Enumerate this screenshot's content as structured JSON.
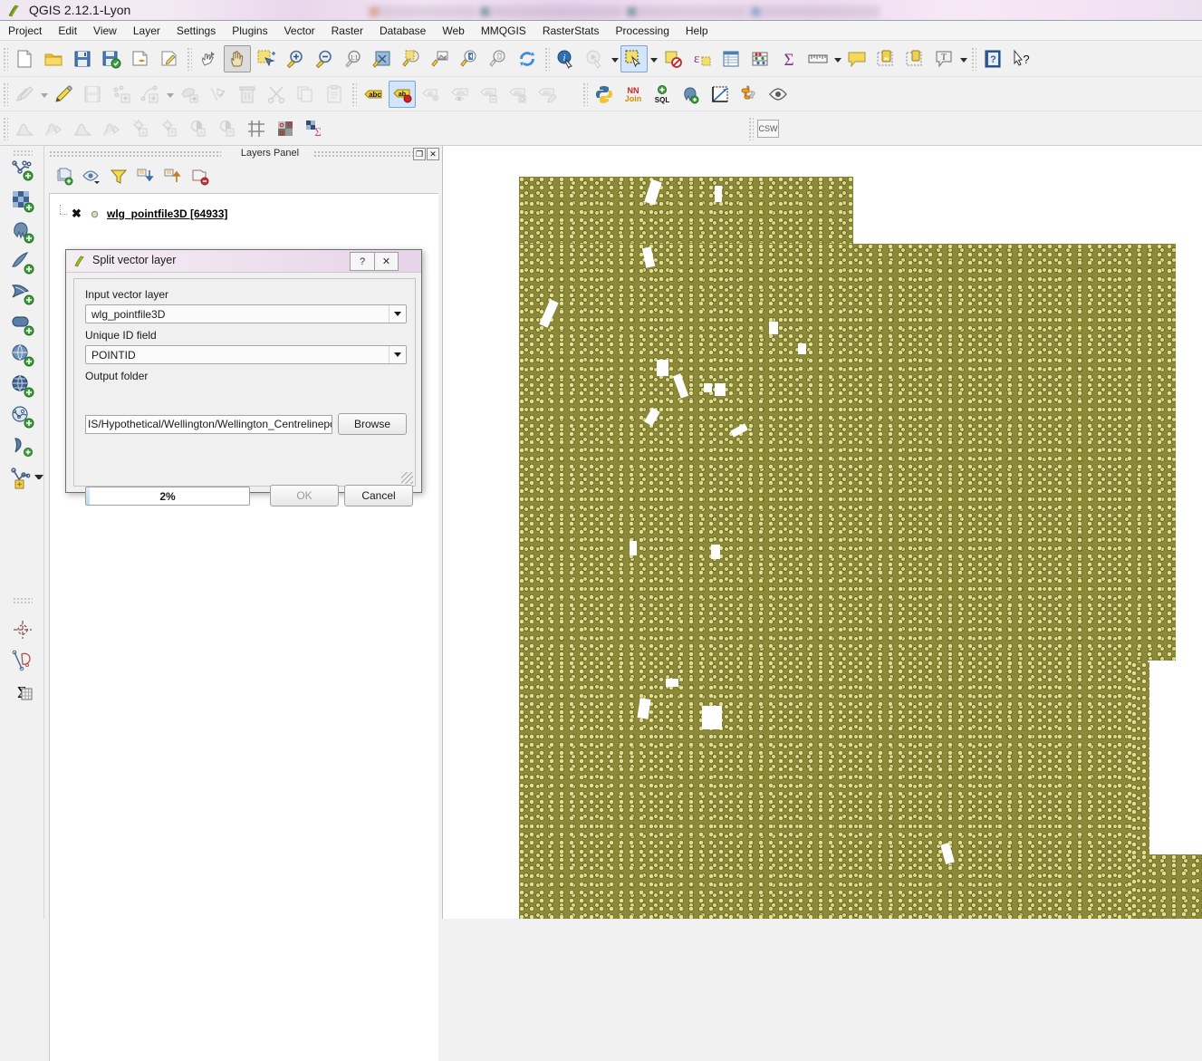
{
  "window": {
    "app_title": "QGIS 2.12.1-Lyon",
    "logo_icon": "qgis-leaf-icon"
  },
  "menubar": {
    "items": [
      {
        "label": "Project"
      },
      {
        "label": "Edit"
      },
      {
        "label": "View"
      },
      {
        "label": "Layer"
      },
      {
        "label": "Settings"
      },
      {
        "label": "Plugins"
      },
      {
        "label": "Vector"
      },
      {
        "label": "Raster"
      },
      {
        "label": "Database"
      },
      {
        "label": "Web"
      },
      {
        "label": "MMQGIS"
      },
      {
        "label": "RasterStats"
      },
      {
        "label": "Processing"
      },
      {
        "label": "Help"
      }
    ]
  },
  "toolbars": {
    "row1": [
      {
        "name": "new-project-icon",
        "type": "button"
      },
      {
        "name": "open-project-icon",
        "type": "button"
      },
      {
        "name": "save-project-icon",
        "type": "button"
      },
      {
        "name": "save-project-as-icon",
        "type": "button"
      },
      {
        "name": "new-print-composer-icon",
        "type": "button"
      },
      {
        "name": "composer-manager-icon",
        "type": "button"
      },
      {
        "name": "separator",
        "type": "sep"
      },
      {
        "name": "touch-zoom-pan-icon",
        "type": "button"
      },
      {
        "name": "pan-map-icon",
        "type": "button",
        "state": "active"
      },
      {
        "name": "pan-to-selection-icon",
        "type": "button"
      },
      {
        "name": "zoom-in-icon",
        "type": "button"
      },
      {
        "name": "zoom-out-icon",
        "type": "button"
      },
      {
        "name": "zoom-native-resolution-icon",
        "type": "button"
      },
      {
        "name": "zoom-full-extent-icon",
        "type": "button"
      },
      {
        "name": "zoom-to-selection-icon",
        "type": "button"
      },
      {
        "name": "zoom-to-layer-icon",
        "type": "button"
      },
      {
        "name": "zoom-last-icon",
        "type": "button"
      },
      {
        "name": "zoom-next-icon",
        "type": "button"
      },
      {
        "name": "refresh-icon",
        "type": "button"
      },
      {
        "name": "separator",
        "type": "sep"
      },
      {
        "name": "identify-features-icon",
        "type": "button"
      },
      {
        "name": "run-feature-action-icon",
        "type": "button",
        "state": "disabled"
      },
      {
        "name": "feature-action-dropdown-caret",
        "type": "caret"
      },
      {
        "name": "select-features-icon",
        "type": "button",
        "state": "selected"
      },
      {
        "name": "select-dropdown-caret",
        "type": "caret"
      },
      {
        "name": "deselect-features-icon",
        "type": "button"
      },
      {
        "name": "select-by-expression-icon",
        "type": "button"
      },
      {
        "name": "open-attribute-table-icon",
        "type": "button"
      },
      {
        "name": "field-calculator-icon",
        "type": "button"
      },
      {
        "name": "statistical-summary-icon",
        "type": "button"
      },
      {
        "name": "measure-line-icon",
        "type": "button"
      },
      {
        "name": "measure-dropdown-caret",
        "type": "caret"
      },
      {
        "name": "map-tips-icon",
        "type": "button"
      },
      {
        "name": "new-bookmark-icon",
        "type": "button"
      },
      {
        "name": "show-bookmarks-icon",
        "type": "button"
      },
      {
        "name": "text-annotation-icon",
        "type": "button"
      },
      {
        "name": "annotation-dropdown-caret",
        "type": "caret"
      },
      {
        "name": "separator",
        "type": "sep"
      },
      {
        "name": "help-contents-icon",
        "type": "button"
      },
      {
        "name": "whats-this-icon",
        "type": "button"
      }
    ],
    "row2": [
      {
        "name": "current-edits-icon",
        "type": "button",
        "state": "disabled"
      },
      {
        "name": "current-edits-caret",
        "type": "caret",
        "state": "disabled"
      },
      {
        "name": "toggle-editing-icon",
        "type": "button"
      },
      {
        "name": "save-layer-edits-icon",
        "type": "button",
        "state": "disabled"
      },
      {
        "name": "add-feature-icon",
        "type": "button",
        "state": "disabled"
      },
      {
        "name": "add-line-feature-icon",
        "type": "button",
        "state": "disabled"
      },
      {
        "name": "add-feature-caret",
        "type": "caret",
        "state": "disabled"
      },
      {
        "name": "move-feature-icon",
        "type": "button",
        "state": "disabled"
      },
      {
        "name": "node-tool-icon",
        "type": "button",
        "state": "disabled"
      },
      {
        "name": "delete-selected-icon",
        "type": "button",
        "state": "disabled"
      },
      {
        "name": "cut-features-icon",
        "type": "button",
        "state": "disabled"
      },
      {
        "name": "copy-features-icon",
        "type": "button",
        "state": "disabled"
      },
      {
        "name": "paste-features-icon",
        "type": "button",
        "state": "disabled"
      },
      {
        "name": "separator",
        "type": "sep"
      },
      {
        "name": "layer-labeling-icon",
        "type": "button"
      },
      {
        "name": "layer-diagram-icon",
        "type": "button",
        "state": "selected"
      },
      {
        "name": "pin-labels-icon",
        "type": "button",
        "state": "disabled"
      },
      {
        "name": "show-hide-labels-icon",
        "type": "button",
        "state": "disabled"
      },
      {
        "name": "move-label-icon",
        "type": "button",
        "state": "disabled"
      },
      {
        "name": "rotate-label-icon",
        "type": "button",
        "state": "disabled"
      },
      {
        "name": "change-label-icon",
        "type": "button",
        "state": "disabled"
      },
      {
        "name": "separator",
        "type": "sep"
      },
      {
        "name": "python-console-icon",
        "type": "button"
      },
      {
        "name": "nnjoin-icon",
        "type": "button"
      },
      {
        "name": "sql-plus-icon",
        "type": "button"
      },
      {
        "name": "postgis-manager-icon",
        "type": "button"
      },
      {
        "name": "plot-tool-icon",
        "type": "button"
      },
      {
        "name": "plugin-manager-icon",
        "type": "button"
      },
      {
        "name": "show-all-layers-icon",
        "type": "button"
      }
    ],
    "row3": [
      {
        "name": "raster-histogram-icon",
        "type": "button",
        "state": "disabled"
      },
      {
        "name": "raster-histogram-stretch-icon",
        "type": "button",
        "state": "disabled"
      },
      {
        "name": "raster-cumulative-cut-icon",
        "type": "button",
        "state": "disabled"
      },
      {
        "name": "raster-cumulative-stretch-icon",
        "type": "button",
        "state": "disabled"
      },
      {
        "name": "increase-brightness-icon",
        "type": "button",
        "state": "disabled"
      },
      {
        "name": "decrease-brightness-icon",
        "type": "button",
        "state": "disabled"
      },
      {
        "name": "increase-contrast-icon",
        "type": "button",
        "state": "disabled"
      },
      {
        "name": "decrease-contrast-icon",
        "type": "button",
        "state": "disabled"
      },
      {
        "name": "grid-icon",
        "type": "button"
      },
      {
        "name": "raster-cells-icon",
        "type": "button"
      },
      {
        "name": "raster-stats-sigma-icon",
        "type": "button"
      }
    ],
    "row3_right": [
      {
        "name": "csw-metasearch-icon",
        "label": "CSW"
      }
    ]
  },
  "left_toolbar": {
    "items": [
      {
        "name": "add-vector-layer-icon"
      },
      {
        "name": "add-raster-layer-icon"
      },
      {
        "name": "add-postgis-layer-icon"
      },
      {
        "name": "add-spatialite-layer-icon"
      },
      {
        "name": "add-mssql-layer-icon"
      },
      {
        "name": "add-oracle-layer-icon"
      },
      {
        "name": "add-wms-layer-icon"
      },
      {
        "name": "add-wcs-layer-icon"
      },
      {
        "name": "add-wfs-layer-icon"
      },
      {
        "name": "add-delimited-text-layer-icon"
      },
      {
        "name": "new-vector-layer-icon"
      }
    ],
    "lower_items": [
      {
        "name": "new-shapefile-layer-icon"
      },
      {
        "name": "create-vector-layer-icon"
      },
      {
        "name": "zonal-statistics-icon"
      }
    ]
  },
  "layers_panel": {
    "title": "Layers Panel",
    "float_label": "❐",
    "close_label": "✕",
    "toolbar": [
      {
        "name": "add-layer-group-icon"
      },
      {
        "name": "manage-layer-visibility-icon"
      },
      {
        "name": "filter-legend-icon"
      },
      {
        "name": "expand-all-icon"
      },
      {
        "name": "collapse-all-icon"
      },
      {
        "name": "remove-layer-icon"
      }
    ],
    "layers": [
      {
        "name": "wlg_pointfile3D [64933]",
        "checked_glyph": "✖",
        "symbol": "point-symbol-icon"
      }
    ]
  },
  "dialog": {
    "icon": "qgis-processing-icon",
    "title": "Split vector layer",
    "help_label": "?",
    "close_label": "✕",
    "fields": [
      {
        "label": "Input vector layer",
        "value": "wlg_pointfile3D",
        "type": "combo"
      },
      {
        "label": "Unique ID field",
        "value": "POINTID",
        "type": "combo"
      }
    ],
    "output_folder_label": "Output folder",
    "output_folder_value": "IS/Hypothetical/Wellington/Wellington_Centrelinepoints",
    "browse_label": "Browse",
    "progress_text": "2%",
    "progress_value": 2,
    "ok_label": "OK",
    "cancel_label": "Cancel"
  },
  "map": {
    "point_color": "#dedc8c",
    "point_outline": "#33330f",
    "background": "#ffffff"
  }
}
